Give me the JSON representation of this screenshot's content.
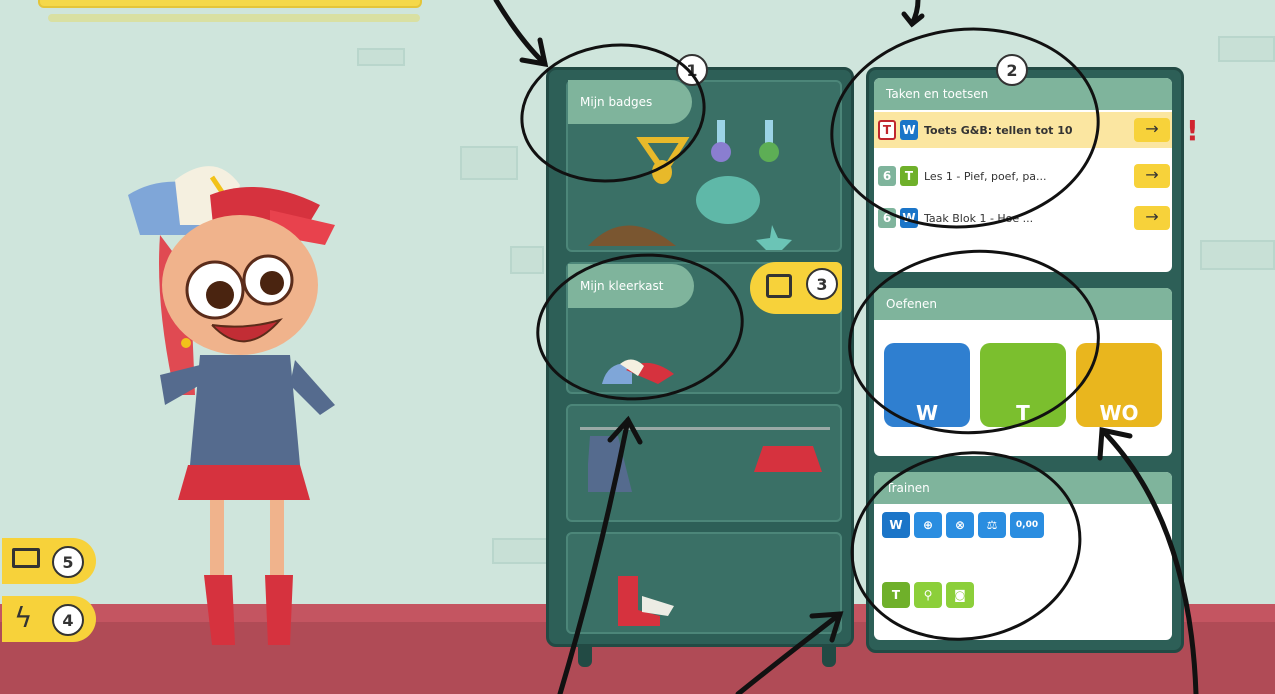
{
  "shelves": {
    "badges_label": "Mijn badges",
    "wardrobe_label": "Mijn kleerkast"
  },
  "tasks_panel": {
    "title": "Taken en toetsen",
    "items": [
      {
        "type_badge": "T",
        "subject_badge": "W",
        "name": "Toets G&B: tellen tot 10",
        "arrow": "→",
        "alert": "!"
      },
      {
        "type_badge": "6",
        "subject_badge": "T",
        "name": "Les 1 - Pief, poef, pa...",
        "arrow": "→"
      },
      {
        "type_badge": "6",
        "subject_badge": "W",
        "name": "Taak Blok 1 - Hoe ...",
        "arrow": "→"
      }
    ]
  },
  "practice_panel": {
    "title": "Oefenen",
    "tiles": [
      {
        "label": "W",
        "color": "#2f7fd0"
      },
      {
        "label": "T",
        "color": "#7bbf2e"
      },
      {
        "label": "WO",
        "color": "#e9b61e"
      }
    ]
  },
  "trainer_panel": {
    "title": "Trainen",
    "w_buttons": [
      "W",
      "⊕",
      "⊗",
      "⚖",
      "0,00"
    ],
    "t_buttons": [
      "T",
      "⚲",
      "◙"
    ]
  },
  "callouts": [
    "1",
    "2",
    "3",
    "4",
    "5"
  ],
  "colors": {
    "cabinet": "#2d5f57",
    "accent": "#f7d23a",
    "floor": "#b04b56"
  }
}
